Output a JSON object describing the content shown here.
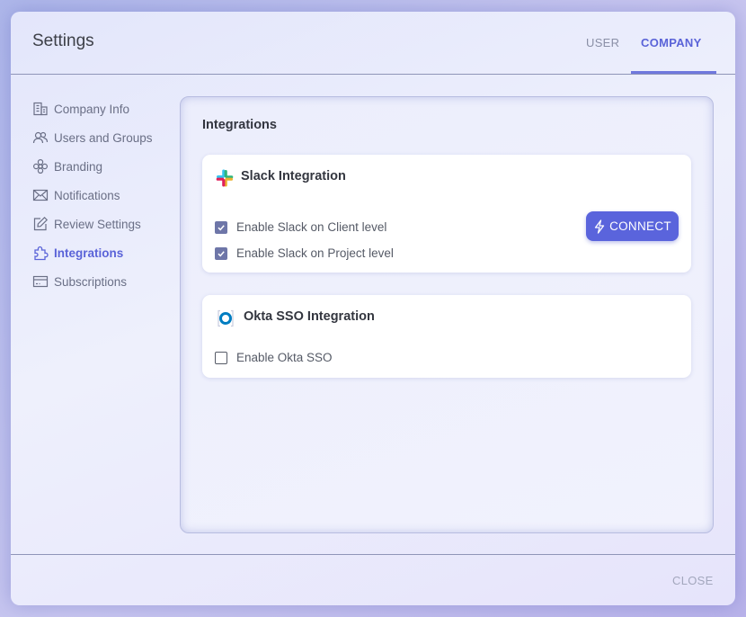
{
  "header": {
    "title": "Settings",
    "tabs": [
      {
        "label": "USER",
        "active": false
      },
      {
        "label": "COMPANY",
        "active": true
      }
    ]
  },
  "sidebar": {
    "items": [
      {
        "label": "Company Info",
        "icon": "building-icon",
        "active": false
      },
      {
        "label": "Users and Groups",
        "icon": "users-icon",
        "active": false
      },
      {
        "label": "Branding",
        "icon": "flower-icon",
        "active": false
      },
      {
        "label": "Notifications",
        "icon": "envelope-icon",
        "active": false
      },
      {
        "label": "Review Settings",
        "icon": "edit-icon",
        "active": false
      },
      {
        "label": "Integrations",
        "icon": "puzzle-icon",
        "active": true
      },
      {
        "label": "Subscriptions",
        "icon": "card-icon",
        "active": false
      }
    ]
  },
  "main": {
    "title": "Integrations",
    "slack": {
      "title": "Slack Integration",
      "options": [
        {
          "label": "Enable Slack on Client level",
          "checked": true
        },
        {
          "label": "Enable Slack on Project level",
          "checked": true
        }
      ],
      "connect_label": "CONNECT"
    },
    "okta": {
      "title": "Okta SSO Integration",
      "options": [
        {
          "label": "Enable Okta SSO",
          "checked": false
        }
      ]
    }
  },
  "footer": {
    "close_label": "CLOSE"
  },
  "colors": {
    "accent": "#5a63d8",
    "button": "#5a64dc",
    "checkbox_checked": "#6e76a8",
    "muted_text": "#6a6f86"
  }
}
